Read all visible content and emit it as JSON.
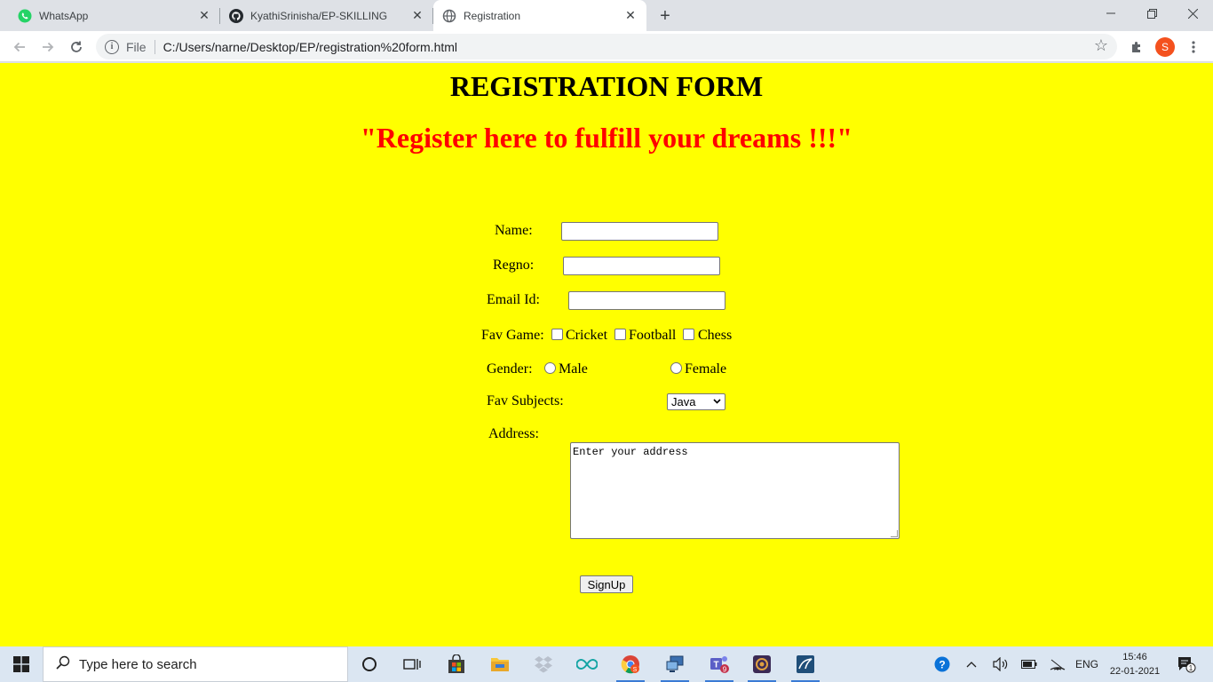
{
  "browser": {
    "tabs": [
      {
        "title": "WhatsApp",
        "icon": "whatsapp-icon"
      },
      {
        "title": "KyathiSrinisha/EP-SKILLING",
        "icon": "github-icon"
      },
      {
        "title": "Registration",
        "icon": "globe-icon",
        "active": true
      }
    ],
    "address": {
      "scheme_label": "File",
      "url": "C:/Users/narne/Desktop/EP/registration%20form.html"
    },
    "profile_initial": "S"
  },
  "page": {
    "heading": "REGISTRATION FORM",
    "tagline": "\"Register here to fulfill your dreams !!!\"",
    "background": "#ffff00",
    "tagline_color": "#ff0000",
    "form": {
      "name_label": "Name:",
      "regno_label": "Regno:",
      "email_label": "Email Id:",
      "fav_game_label": "Fav Game:",
      "games": [
        "Cricket",
        "Football",
        "Chess"
      ],
      "gender_label": "Gender:",
      "genders": [
        "Male",
        "Female"
      ],
      "fav_subjects_label": "Fav Subjects:",
      "subject_selected": "Java",
      "address_label": "Address:",
      "address_value": "Enter your address",
      "submit_label": "SignUp"
    }
  },
  "taskbar": {
    "search_placeholder": "Type here to search",
    "language": "ENG",
    "time": "15:46",
    "date": "22-01-2021",
    "teams_badge": "9",
    "notification_count": "1"
  }
}
